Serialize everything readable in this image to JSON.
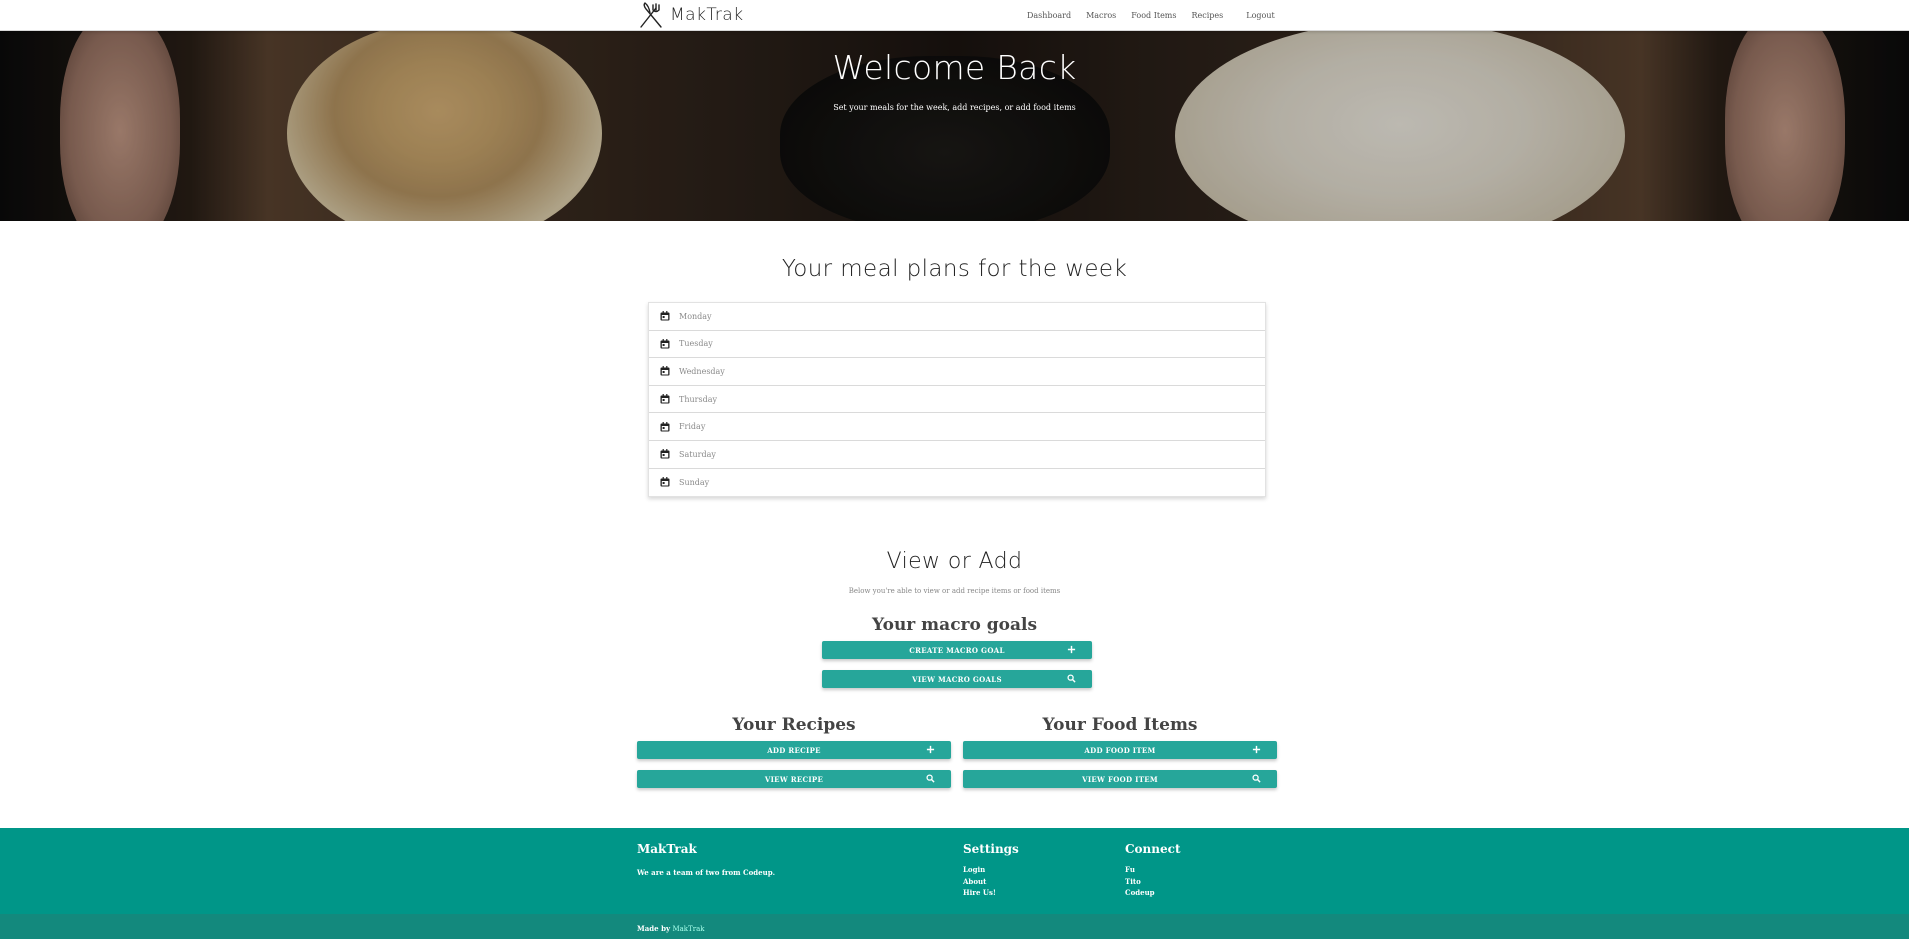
{
  "nav": {
    "brand": "MakTrak",
    "links": [
      "Dashboard",
      "Macros",
      "Food Items",
      "Recipes",
      "Logout"
    ]
  },
  "hero": {
    "title": "Welcome Back",
    "subtitle": "Set your meals for the week, add recipes, or add food items"
  },
  "meal_plans": {
    "title": "Your meal plans for the week",
    "days": [
      "Monday",
      "Tuesday",
      "Wednesday",
      "Thursday",
      "Friday",
      "Saturday",
      "Sunday"
    ]
  },
  "view_add": {
    "title": "View or Add",
    "subtitle": "Below you're able to view or add recipe items or food items",
    "macro": {
      "title": "Your macro goals",
      "create_label": "Create Macro Goal",
      "view_label": "View Macro Goals"
    },
    "recipes": {
      "title": "Your Recipes",
      "add_label": "Add Recipe",
      "view_label": "View Recipe"
    },
    "food": {
      "title": "Your Food Items",
      "add_label": "Add Food Item",
      "view_label": "View Food Item"
    }
  },
  "footer": {
    "brand_title": "MakTrak",
    "brand_text": "We are a team of two from Codeup.",
    "settings_title": "Settings",
    "settings_links": [
      "Login",
      "About",
      "Hire Us!"
    ],
    "connect_title": "Connect",
    "connect_links": [
      "Fu",
      "Tito",
      "Codeup"
    ],
    "made_by_prefix": "Made by",
    "made_by_link": "MakTrak"
  },
  "colors": {
    "accent": "#26a69a",
    "footer": "#009688",
    "footer_bottom": "#13897d"
  },
  "icons": {
    "brand": "fork-knife-icon",
    "day": "calendar-icon",
    "add": "plus-icon",
    "view": "search-icon"
  }
}
